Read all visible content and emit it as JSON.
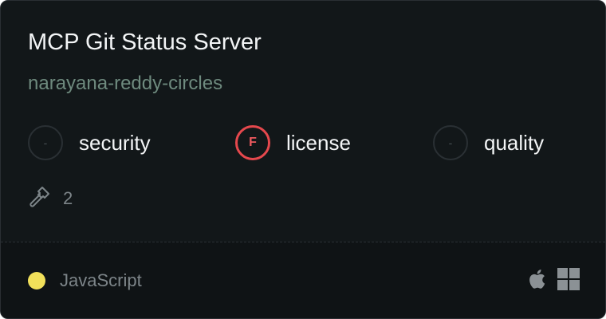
{
  "server": {
    "title": "MCP Git Status Server",
    "owner": "narayana-reddy-circles"
  },
  "scores": [
    {
      "name": "security",
      "grade": "-",
      "status": "none"
    },
    {
      "name": "license",
      "grade": "F",
      "status": "fail"
    },
    {
      "name": "quality",
      "grade": "-",
      "status": "none"
    }
  ],
  "tools": {
    "icon": "hammer-icon",
    "count": "2"
  },
  "footer": {
    "language": "JavaScript",
    "language_color": "#f1e05a",
    "platforms": [
      "apple-icon",
      "windows-icon"
    ]
  },
  "colors": {
    "fail": "#e5484d",
    "owner": "#6e8a7e"
  }
}
